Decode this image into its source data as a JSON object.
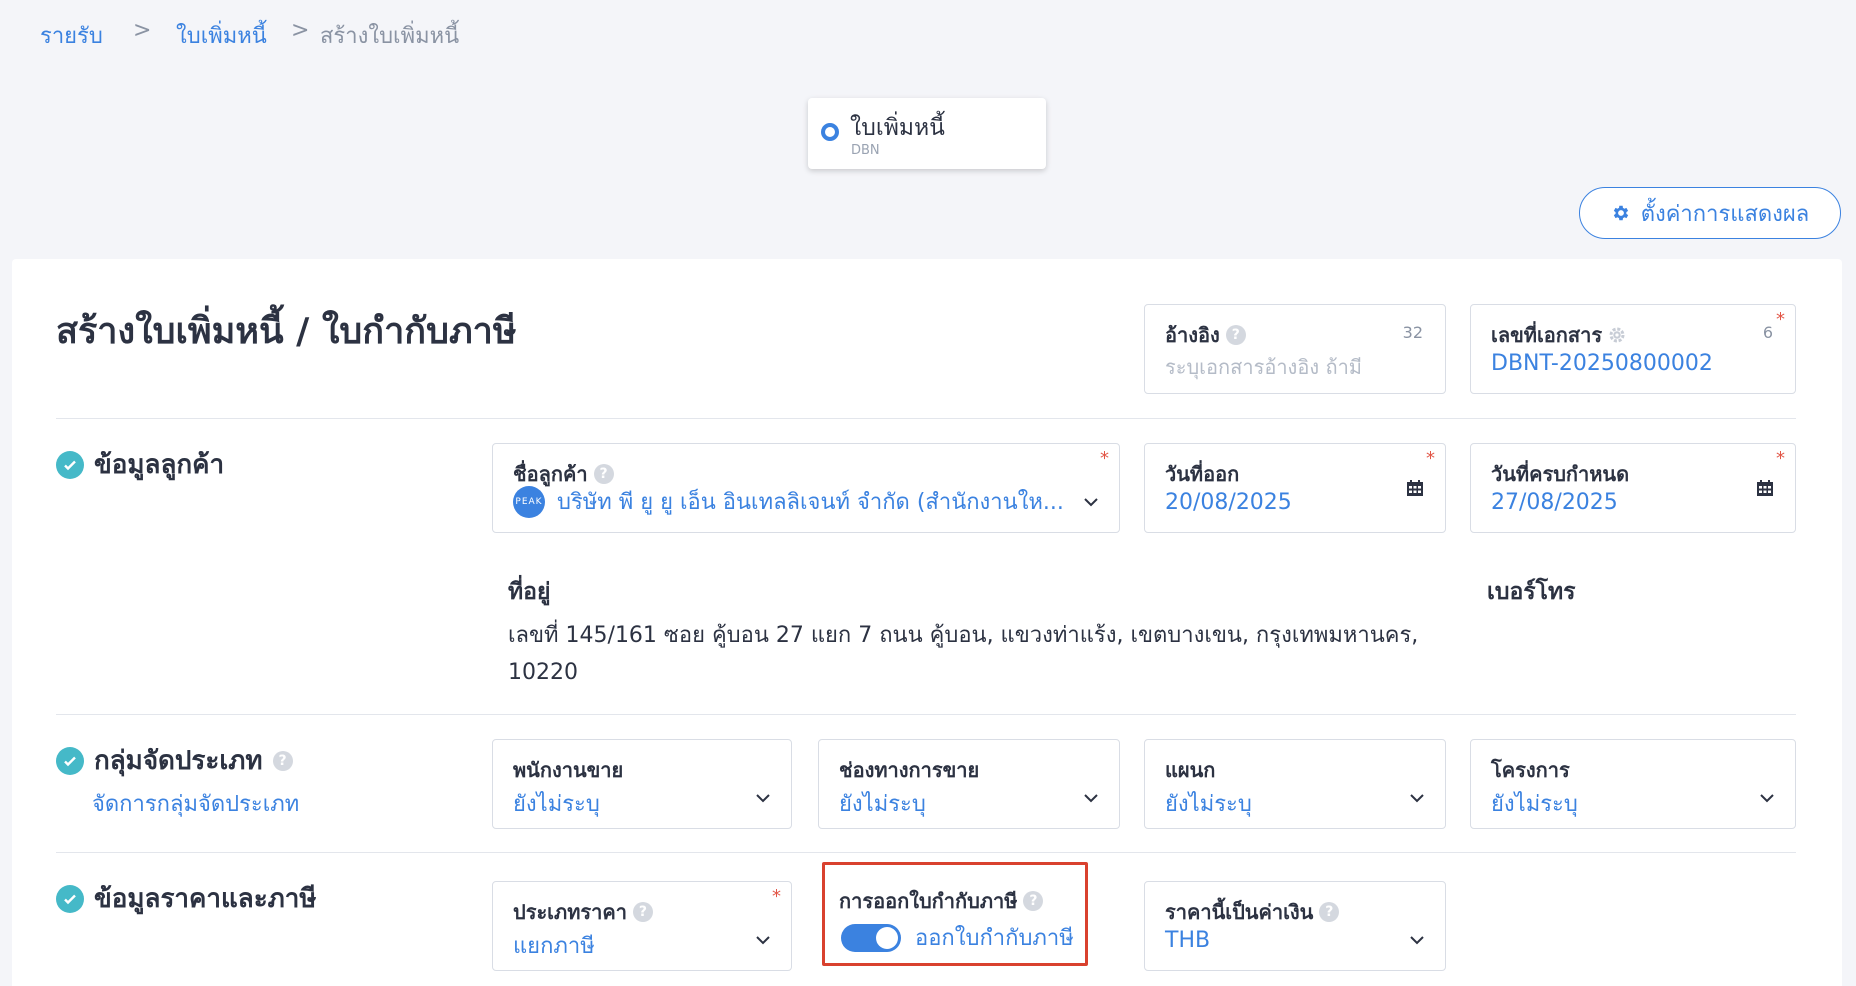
{
  "breadcrumb": {
    "items": [
      "รายรับ",
      "ใบเพิ่มหนี้",
      "สร้างใบเพิ่มหนี้"
    ],
    "separator": ">"
  },
  "doc_type": {
    "title": "ใบเพิ่มหนี้",
    "code": "DBN"
  },
  "settings_button": {
    "label": "ตั้งค่าการแสดงผล",
    "icon": "gear-icon"
  },
  "page_title": "สร้างใบเพิ่มหนี้ / ใบกำกับภาษี",
  "reference": {
    "label": "อ้างอิง",
    "placeholder": "ระบุเอกสารอ้างอิง ถ้ามี",
    "counter": "32"
  },
  "doc_number": {
    "label": "เลขที่เอกสาร",
    "value": "DBNT-20250800002",
    "counter": "6",
    "required": "*"
  },
  "customer_section": {
    "title": "ข้อมูลลูกค้า",
    "customer": {
      "label": "ชื่อลูกค้า",
      "value": "บริษัท พี ยู ยู เอ็น อินเทลลิเจนท์ จำกัด (สำนักงานให...",
      "avatar": "PEAK",
      "required": "*"
    },
    "issue_date": {
      "label": "วันที่ออก",
      "value": "20/08/2025",
      "required": "*"
    },
    "due_date": {
      "label": "วันที่ครบกำหนด",
      "value": "27/08/2025",
      "required": "*"
    },
    "address_label": "ที่อยู่",
    "address_line1": "เลขที่ 145/161 ซอย คู้บอน 27 แยก 7 ถนน คู้บอน, แขวงท่าแร้ง, เขตบางเขน, กรุงเทพมหานคร,",
    "address_line2": "10220",
    "phone_label": "เบอร์โทร"
  },
  "group_section": {
    "title": "กลุ่มจัดประเภท",
    "manage_link": "จัดการกลุ่มจัดประเภท",
    "fields": [
      {
        "label": "พนักงานขาย",
        "value": "ยังไม่ระบุ"
      },
      {
        "label": "ช่องทางการขาย",
        "value": "ยังไม่ระบุ"
      },
      {
        "label": "แผนก",
        "value": "ยังไม่ระบุ"
      },
      {
        "label": "โครงการ",
        "value": "ยังไม่ระบุ"
      }
    ]
  },
  "price_section": {
    "title": "ข้อมูลราคาและภาษี",
    "price_type": {
      "label": "ประเภทราคา",
      "value": "แยกภาษี",
      "required": "*"
    },
    "tax_invoice": {
      "label": "การออกใบกำกับภาษี",
      "toggle_label": "ออกใบกำกับภาษี",
      "enabled": true
    },
    "currency": {
      "label": "ราคานี้เป็นค่าเงิน",
      "value": "THB"
    }
  },
  "colors": {
    "accent": "#3b82e0",
    "check": "#45b9c8",
    "highlight": "#d9412e",
    "required": "#e25546"
  }
}
